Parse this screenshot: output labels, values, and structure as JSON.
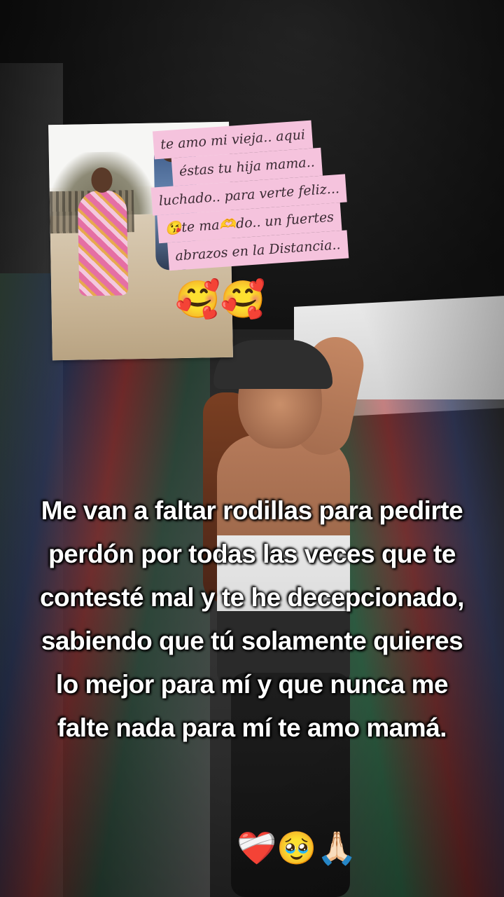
{
  "note": {
    "lines": [
      "te amo mi vieja.. aqui",
      "éstas tu hija mama..",
      "luchado.. para verte feliz...",
      "😘te ma🫶do.. un fuertes",
      "abrazos en la Distancia.."
    ]
  },
  "sticker_emojis": "🥰🥰",
  "caption": {
    "text": "Me van a faltar rodillas para pedirte perdón por todas las veces que te contesté mal y te he decepcionado, sabiendo que tú solamente quieres lo mejor para mí y que nunca me falte nada para mí te amo mamá."
  },
  "caption_emojis": "❤️‍🩹🥹🙏🏻"
}
